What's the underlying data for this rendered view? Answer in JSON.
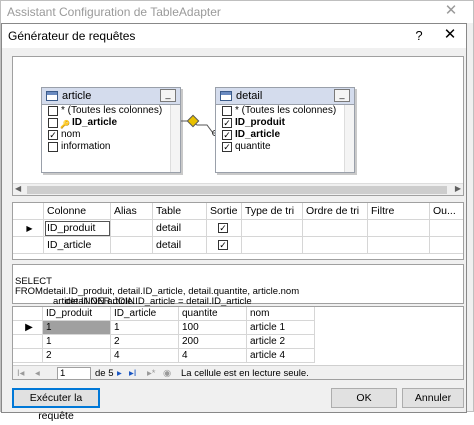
{
  "outer_window": {
    "title": "Assistant Configuration de TableAdapter",
    "close_glyph": "✕"
  },
  "dialog": {
    "title": "Générateur de requêtes",
    "help_glyph": "?",
    "close_glyph": "✕"
  },
  "diagram": {
    "tables": [
      {
        "name": "article",
        "min_glyph": "_",
        "columns": [
          {
            "label": "* (Toutes les colonnes)",
            "checked": false,
            "key": false
          },
          {
            "label": "ID_article",
            "checked": false,
            "key": true
          },
          {
            "label": "nom",
            "checked": true,
            "key": false
          },
          {
            "label": "information",
            "checked": false,
            "key": false
          }
        ]
      },
      {
        "name": "detail",
        "min_glyph": "_",
        "columns": [
          {
            "label": "* (Toutes les colonnes)",
            "checked": false,
            "key": false
          },
          {
            "label": "ID_produit",
            "checked": true,
            "key": true
          },
          {
            "label": "ID_article",
            "checked": true,
            "key": true
          },
          {
            "label": "quantite",
            "checked": true,
            "key": false
          }
        ]
      }
    ]
  },
  "criteria": {
    "headers": [
      "Colonne",
      "Alias",
      "Table",
      "Sortie",
      "Type de tri",
      "Ordre de tri",
      "Filtre",
      "Ou..."
    ],
    "rows": [
      {
        "pointer": "▶",
        "column": "ID_produit",
        "alias": "",
        "table": "detail",
        "output": true
      },
      {
        "pointer": "",
        "column": "ID_article",
        "alias": "",
        "table": "detail",
        "output": true
      }
    ]
  },
  "sql": {
    "select_kw": "SELECT",
    "select_text": "detail.ID_produit, detail.ID_article, detail.quantite, article.nom",
    "from_kw": "FROM",
    "from_line1": "article INNER JOIN",
    "from_line2": "detail ON article.ID_article = detail.ID_article"
  },
  "results": {
    "headers": [
      "ID_produit",
      "ID_article",
      "quantite",
      "nom"
    ],
    "rows": [
      {
        "pointer": "▶",
        "cells": [
          "1",
          "1",
          "100",
          "article 1"
        ]
      },
      {
        "pointer": "",
        "cells": [
          "1",
          "2",
          "200",
          "article 2"
        ]
      },
      {
        "pointer": "",
        "cells": [
          "2",
          "4",
          "4",
          "article 4"
        ]
      }
    ],
    "nav": {
      "first": "I◂",
      "prev": "◂",
      "position": "1",
      "of_total": "de 5",
      "next": "▸",
      "last": "▸I",
      "new": "▸*",
      "stop": "◉",
      "status": "La cellule est en lecture seule."
    }
  },
  "buttons": {
    "execute": "Exécuter la requête",
    "ok": "OK",
    "cancel": "Annuler"
  }
}
